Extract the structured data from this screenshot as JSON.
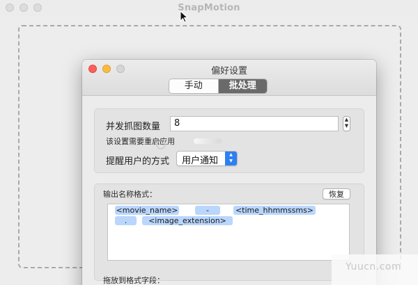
{
  "back_window": {
    "title": "SnapMotion"
  },
  "preferences": {
    "title": "偏好设置",
    "tabs": [
      {
        "label": "手动",
        "selected": false
      },
      {
        "label": "批处理",
        "selected": true
      }
    ],
    "concurrent": {
      "label": "并发抓图数量",
      "value": "8",
      "note": "该设置需要重启应用"
    },
    "notify": {
      "label": "提醒用户的方式",
      "selected": "用户通知"
    },
    "output_format": {
      "label": "输出名称格式：",
      "reset_button": "恢复",
      "tokens": [
        "<movie_name>",
        "-",
        "<time_hhmmssms>",
        ".",
        "<image_extension>"
      ]
    },
    "drag_label": "拖放到格式字段："
  },
  "watermark": "Yuucn.com",
  "colors": {
    "accent": "#2e7ff1",
    "token_bg": "#b9d6fc",
    "selected_tab": "#6a6a6a",
    "close": "#fc605c",
    "minimize": "#fdbc40"
  }
}
